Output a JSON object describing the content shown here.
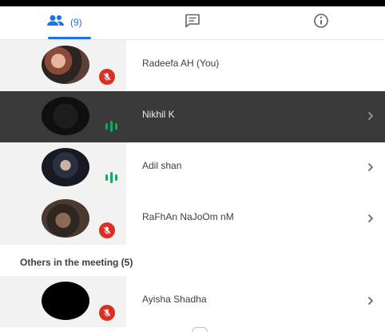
{
  "tabs": {
    "people_count": "(9)"
  },
  "participants": [
    {
      "name": "Radeefa AH (You)",
      "status": "muted"
    },
    {
      "name": "Nikhil K",
      "status": "speaking"
    },
    {
      "name": "Adil shan",
      "status": "speaking"
    },
    {
      "name": "RaFhAn NaJoOm nM",
      "status": "muted"
    }
  ],
  "others": {
    "title": "Others in the meeting (5)",
    "items": [
      {
        "name": "Ayisha Shadha",
        "status": "muted"
      }
    ]
  },
  "colors": {
    "accent": "#1a73e8",
    "muted_badge": "#d93025",
    "speaking": "#1ea362",
    "selected_row": "#3a3a3a"
  }
}
